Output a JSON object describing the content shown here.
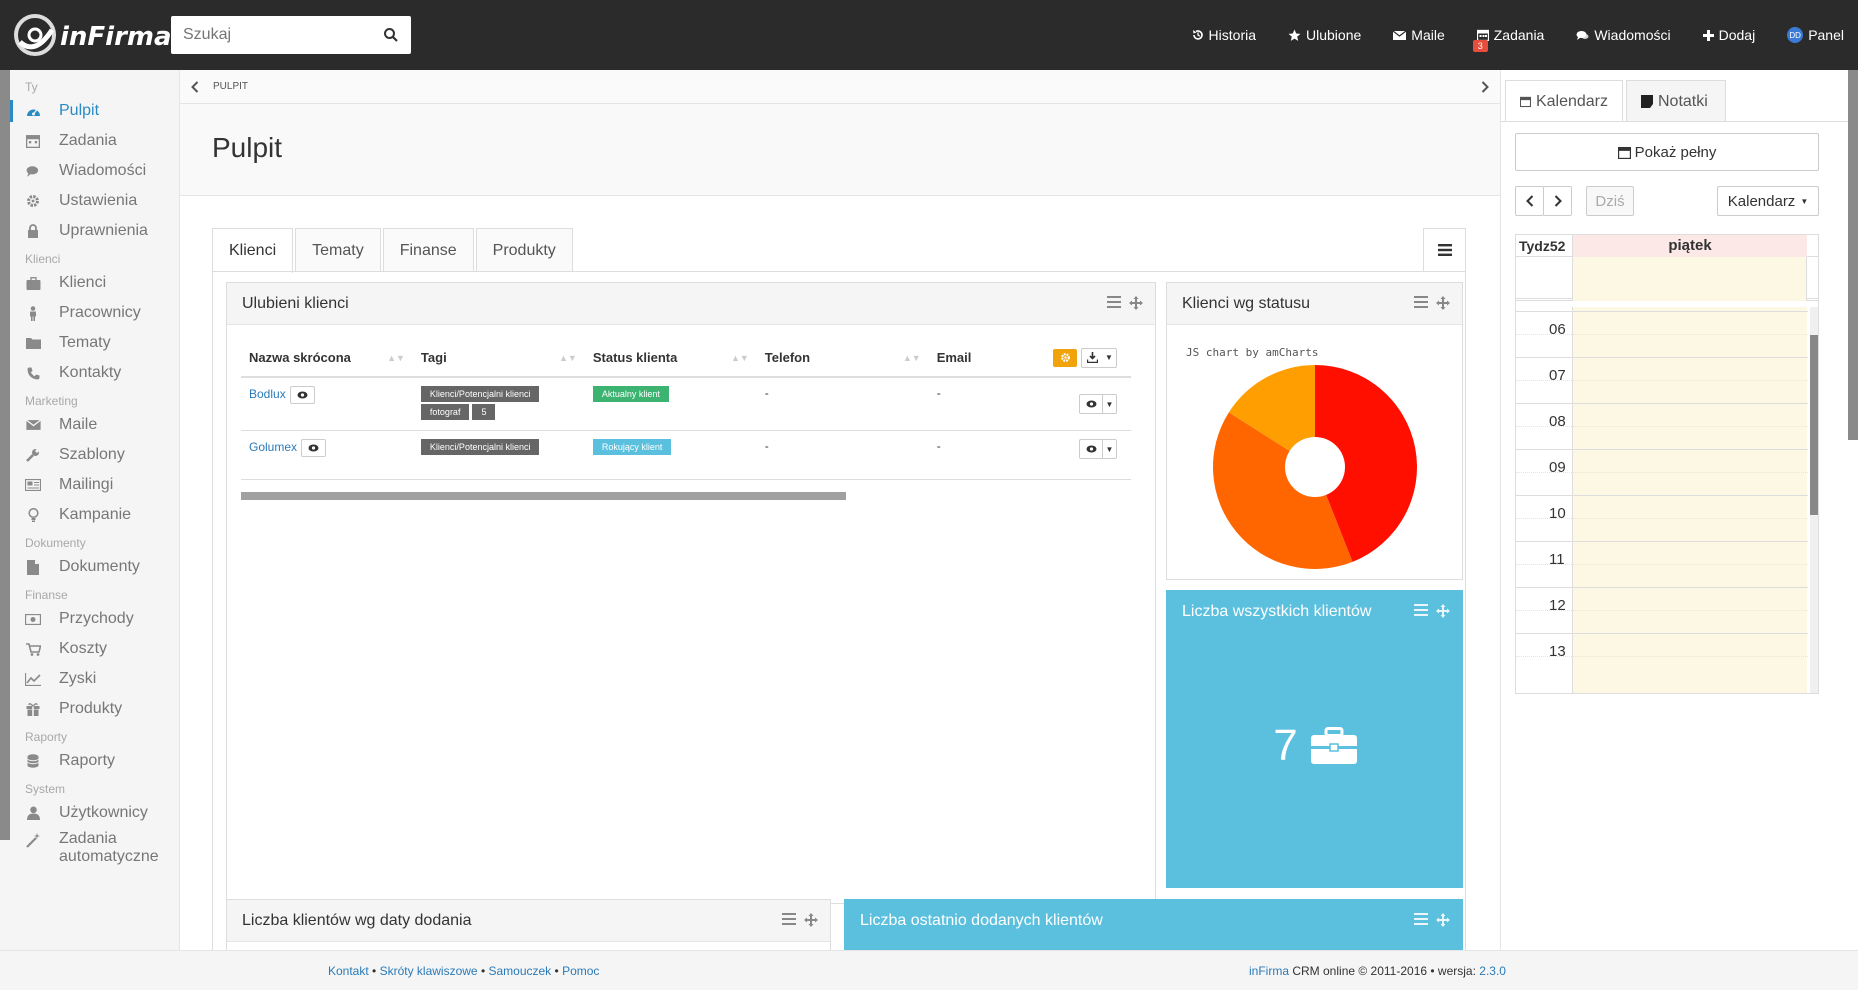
{
  "app": {
    "logo_text": "inFirma",
    "search_placeholder": "Szukaj"
  },
  "topnav": [
    {
      "label": "Historia",
      "icon": "history-icon"
    },
    {
      "label": "Ulubione",
      "icon": "star-icon"
    },
    {
      "label": "Maile",
      "icon": "envelope-icon"
    },
    {
      "label": "Zadania",
      "icon": "calendar-icon",
      "badge": "3"
    },
    {
      "label": "Wiadomości",
      "icon": "comments-icon"
    },
    {
      "label": "Dodaj",
      "icon": "plus-icon"
    },
    {
      "label": "Panel",
      "icon": "avatar-icon",
      "avatar_initials": "DD"
    }
  ],
  "sidebar": {
    "groups": [
      {
        "title": "Ty",
        "items": [
          {
            "label": "Pulpit",
            "icon": "dashboard-icon",
            "active": true
          },
          {
            "label": "Zadania",
            "icon": "calendar-icon"
          },
          {
            "label": "Wiadomości",
            "icon": "comments-icon"
          },
          {
            "label": "Ustawienia",
            "icon": "gear-icon"
          },
          {
            "label": "Uprawnienia",
            "icon": "lock-icon"
          }
        ]
      },
      {
        "title": "Klienci",
        "items": [
          {
            "label": "Klienci",
            "icon": "briefcase-icon"
          },
          {
            "label": "Pracownicy",
            "icon": "person-icon"
          },
          {
            "label": "Tematy",
            "icon": "folder-icon"
          },
          {
            "label": "Kontakty",
            "icon": "phone-icon"
          }
        ]
      },
      {
        "title": "Marketing",
        "items": [
          {
            "label": "Maile",
            "icon": "envelope-icon"
          },
          {
            "label": "Szablony",
            "icon": "wrench-icon"
          },
          {
            "label": "Mailingi",
            "icon": "newspaper-icon"
          },
          {
            "label": "Kampanie",
            "icon": "lightbulb-icon"
          }
        ]
      },
      {
        "title": "Dokumenty",
        "items": [
          {
            "label": "Dokumenty",
            "icon": "file-icon"
          }
        ]
      },
      {
        "title": "Finanse",
        "items": [
          {
            "label": "Przychody",
            "icon": "money-icon"
          },
          {
            "label": "Koszty",
            "icon": "cart-icon"
          },
          {
            "label": "Zyski",
            "icon": "line-chart-icon"
          },
          {
            "label": "Produkty",
            "icon": "gift-icon"
          }
        ]
      },
      {
        "title": "Raporty",
        "items": [
          {
            "label": "Raporty",
            "icon": "database-icon"
          }
        ]
      },
      {
        "title": "System",
        "items": [
          {
            "label": "Użytkownicy",
            "icon": "user-icon"
          },
          {
            "label": "Zadania automatyczne",
            "icon": "magic-icon"
          }
        ]
      }
    ]
  },
  "breadcrumb": "PULPIT",
  "page_title": "Pulpit",
  "tabs": [
    "Klienci",
    "Tematy",
    "Finanse",
    "Produkty"
  ],
  "favorites_panel": {
    "title": "Ulubieni klienci",
    "columns": [
      "Nazwa skrócona",
      "Tagi",
      "Status klienta",
      "Telefon",
      "Email"
    ],
    "rows": [
      {
        "name": "Bodlux",
        "tags": [
          "Klienci/Potencjalni klienci",
          "fotograf",
          "5"
        ],
        "status": "Aktualny klient",
        "status_color": "#3cb371",
        "phone": "-",
        "email": "-"
      },
      {
        "name": "Golumex",
        "tags": [
          "Klienci/Potencjalni klienci"
        ],
        "status": "Rokujący klient",
        "status_color": "#5bc0de",
        "phone": "-",
        "email": "-"
      }
    ]
  },
  "status_panel": {
    "title": "Klienci wg statusu",
    "credit": "JS chart by amCharts"
  },
  "chart_data": {
    "type": "pie",
    "title": "Klienci wg statusu",
    "slices": [
      {
        "value": 44,
        "color": "#ff0f00"
      },
      {
        "value": 40,
        "color": "#ff6600"
      },
      {
        "value": 16,
        "color": "#ff9e01"
      }
    ]
  },
  "count_panel": {
    "title": "Liczba wszystkich klientów",
    "value": "7",
    "icon": "briefcase-icon"
  },
  "bottom_panels": {
    "by_date_title": "Liczba klientów wg daty dodania",
    "recent_title": "Liczba ostatnio dodanych klientów"
  },
  "right": {
    "tabs": [
      "Kalendarz",
      "Notatki"
    ],
    "show_full": "Pokaż pełny",
    "today": "Dziś",
    "calendar_dropdown": "Kalendarz",
    "week_label": "Tydz52",
    "day_label": "piątek",
    "hours": [
      "06",
      "07",
      "08",
      "09",
      "10",
      "11",
      "12",
      "13"
    ]
  },
  "footer": {
    "links": [
      "Kontakt",
      "Skróty klawiszowe",
      "Samouczek",
      "Pomoc"
    ],
    "app_link": "inFirma",
    "copyright": " CRM online © 2011-2016 • wersja: ",
    "version": "2.3.0"
  },
  "colors": {
    "topbar": "#2b2b2b",
    "accent": "#2a8bc4",
    "info_panel": "#5bc0de",
    "gear_button": "#f0a30a"
  }
}
